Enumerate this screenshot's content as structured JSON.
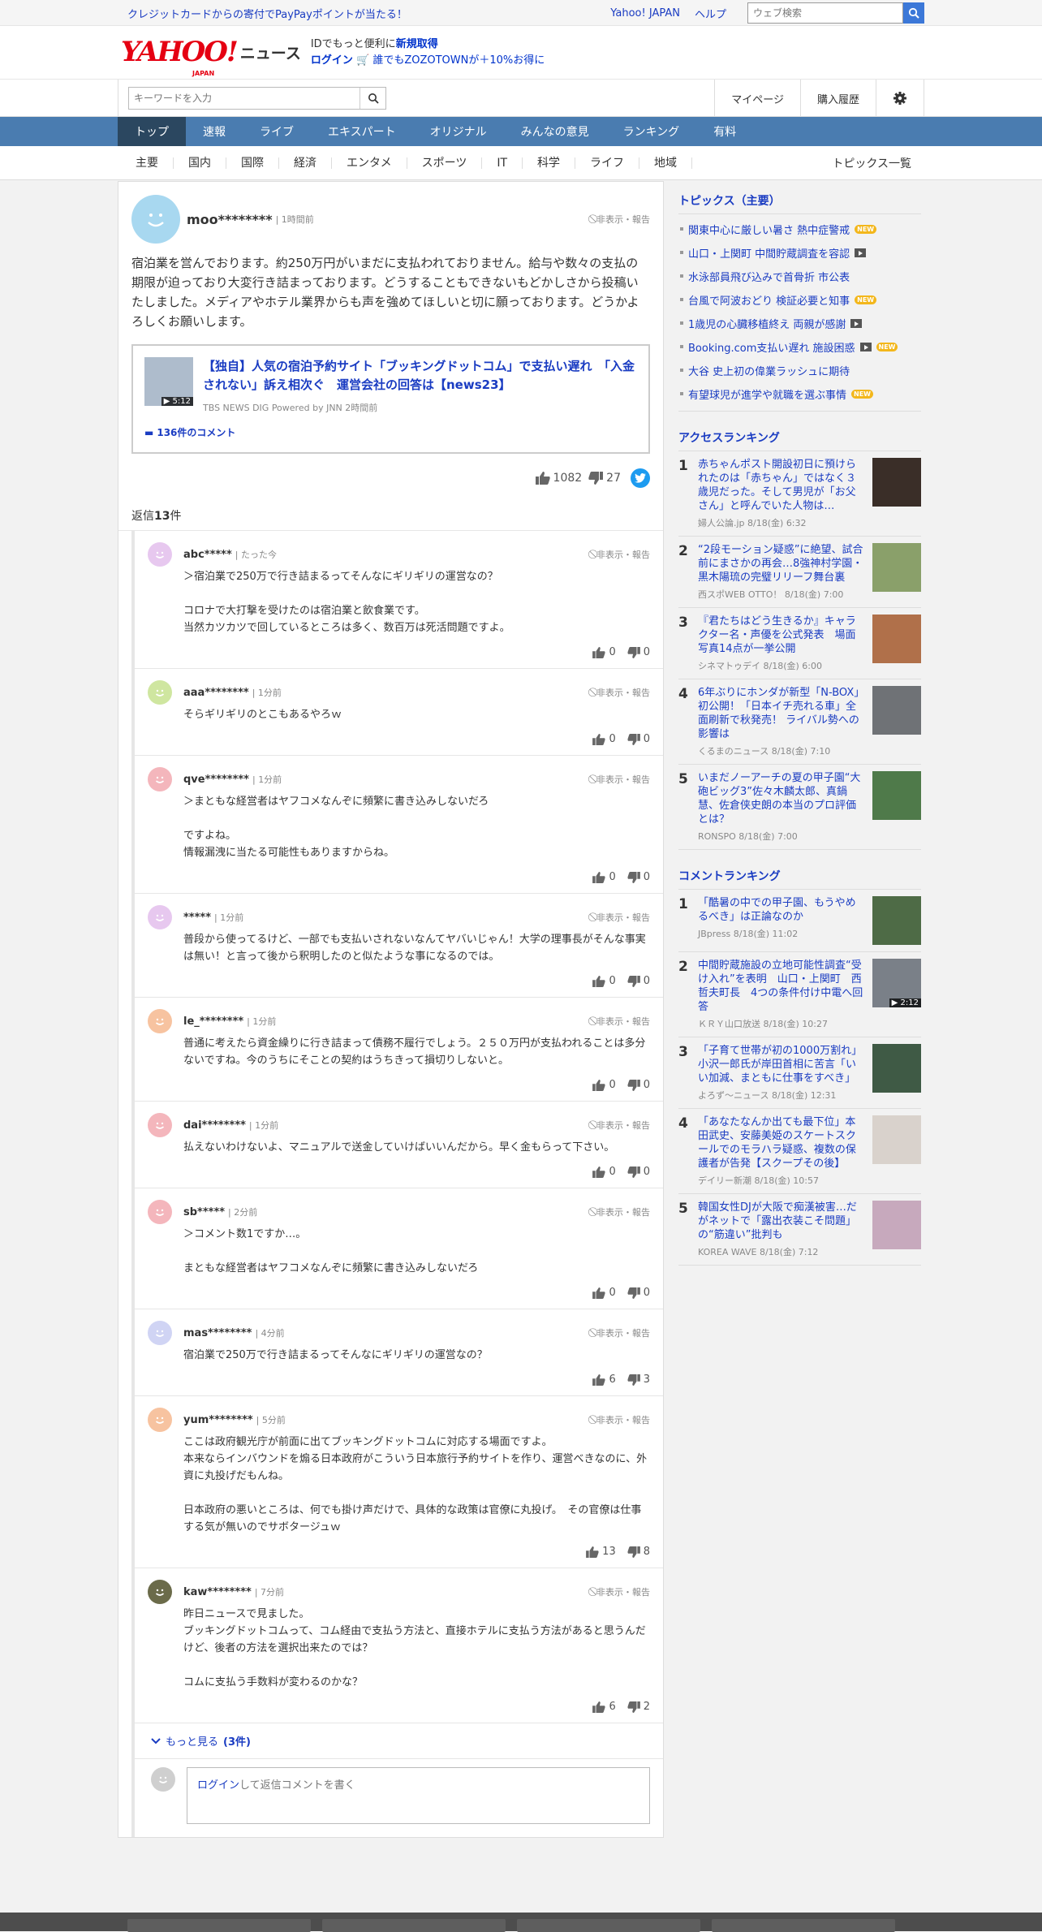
{
  "topbar": {
    "promo": "クレジットカードからの寄付でPayPayポイントが当たる！",
    "links": [
      "Yahoo! JAPAN",
      "ヘルプ"
    ],
    "web_search_placeholder": "ウェブ検索"
  },
  "header": {
    "logo_text": "YAHOO!",
    "logo_sub": "JAPAN",
    "service": "ニュース",
    "line1_prefix": "IDでもっと便利に",
    "line1_link": "新規取得",
    "line2_login": "ログイン",
    "line2_promo": "誰でもZOZOTOWNが＋10%お得に"
  },
  "search": {
    "placeholder": "キーワードを入力",
    "right_nav": [
      "マイページ",
      "購入履歴"
    ]
  },
  "main_nav": [
    "トップ",
    "速報",
    "ライブ",
    "エキスパート",
    "オリジナル",
    "みんなの意見",
    "ランキング",
    "有料"
  ],
  "sub_nav": [
    "主要",
    "国内",
    "国際",
    "経済",
    "エンタメ",
    "スポーツ",
    "IT",
    "科学",
    "ライフ",
    "地域"
  ],
  "sub_nav_right": "トピックス一覧",
  "main_comment": {
    "user": "moo********",
    "time": "1時間前",
    "report": "非表示・報告",
    "text": "宿泊業を営んでおります。約250万円がいまだに支払われておりません。給与や数々の支払の期限が迫っており大変行き詰まっております。どうすることもできないもどかしさから投稿いたしました。メディアやホテル業界からも声を強めてほしいと切に願っております。どうかよろしくお願いします。",
    "article_title": "【独自】人気の宿泊予約サイト「ブッキングドットコム」で支払い遅れ　「入金されない」訴え相次ぐ　運営会社の回答は【news23】",
    "article_source": "TBS NEWS DIG Powered by JNN 2時間前",
    "article_duration": "5:12",
    "comment_count": "136件のコメント",
    "likes": "1082",
    "dislikes": "27"
  },
  "reply_count_label": "返信",
  "reply_count_num": "13",
  "reply_count_suffix": "件",
  "replies": [
    {
      "user": "abc*****",
      "time": "たった今",
      "text": "＞宿泊業で250万で行き詰まるってそんなにギリギリの運営なの？\n\nコロナで大打撃を受けたのは宿泊業と飲食業です。\n当然カツカツで回しているところは多く、数百万は死活問題ですよ。",
      "likes": "0",
      "dislikes": "0",
      "color": "#e7c8ef"
    },
    {
      "user": "aaa********",
      "time": "1分前",
      "text": "そらギリギリのとこもあるやろｗ",
      "likes": "0",
      "dislikes": "0",
      "color": "#cfe6a0"
    },
    {
      "user": "qve********",
      "time": "1分前",
      "text": "＞まともな経営者はヤフコメなんぞに頻繁に書き込みしないだろ\n\nですよね。\n情報漏洩に当たる可能性もありますからね。",
      "likes": "0",
      "dislikes": "0",
      "color": "#f4b6bc"
    },
    {
      "user": "*****",
      "time": "1分前",
      "text": "普段から使ってるけど、一部でも支払いされないなんてヤバいじゃん！大学の理事長がそんな事実は無い！と言って後から釈明したのと似たような事になるのでは。",
      "likes": "0",
      "dislikes": "0",
      "color": "#e7c8ef"
    },
    {
      "user": "le_********",
      "time": "1分前",
      "text": "普通に考えたら資金繰りに行き詰まって債務不履行でしょう。２５０万円が支払われることは多分ないですね。今のうちにそことの契約はうちきって損切りしないと。",
      "likes": "0",
      "dislikes": "0",
      "color": "#f7c3a0"
    },
    {
      "user": "dai********",
      "time": "1分前",
      "text": "払えないわけないよ、マニュアルで送金していけばいいんだから。早く金もらって下さい。",
      "likes": "0",
      "dislikes": "0",
      "color": "#f4b6bc"
    },
    {
      "user": "sb*****",
      "time": "2分前",
      "text": "＞コメント数1ですか…。\n\nまともな経営者はヤフコメなんぞに頻繁に書き込みしないだろ",
      "likes": "0",
      "dislikes": "0",
      "color": "#f4b6bc"
    },
    {
      "user": "mas********",
      "time": "4分前",
      "text": "宿泊業で250万で行き詰まるってそんなにギリギリの運営なの？",
      "likes": "6",
      "dislikes": "3",
      "color": "#d0d4f4"
    },
    {
      "user": "yum********",
      "time": "5分前",
      "text": "ここは政府観光庁が前面に出てブッキングドットコムに対応する場面ですよ。\n本来ならインバウンドを煽る日本政府がこういう日本旅行予約サイトを作り、運営べきなのに、外資に丸投げだもんね。\n\n日本政府の悪いところは、何でも掛け声だけで、具体的な政策は官僚に丸投げ。　その官僚は仕事する気が無いのでサボタージュｗ",
      "likes": "13",
      "dislikes": "8",
      "color": "#f7c3a0"
    },
    {
      "user": "kaw********",
      "time": "7分前",
      "text": "昨日ニュースで見ました。\nブッキングドットコムって、コム経由で支払う方法と、直接ホテルに支払う方法があると思うんだけど、後者の方法を選択出来たのでは？\n\nコムに支払う手数料が変わるのかな？",
      "likes": "6",
      "dislikes": "2",
      "color": "#6b6b4a"
    }
  ],
  "reply_report": "非表示・報告",
  "more_label": "もっと見る",
  "more_count": "(3件)",
  "reply_form_login": "ログイン",
  "reply_form_text": "して返信コメントを書く",
  "sidebar": {
    "topics_title": "トピックス（主要）",
    "topics": [
      {
        "title": "関東中心に厳しい暑さ 熱中症警戒",
        "new": true,
        "video": false
      },
      {
        "title": "山口・上関町 中間貯蔵調査を容認",
        "new": false,
        "video": true
      },
      {
        "title": "水泳部員飛び込みで首骨折 市公表",
        "new": false,
        "video": false
      },
      {
        "title": "台風で阿波おどり 検証必要と知事",
        "new": true,
        "video": false
      },
      {
        "title": "1歳児の心臓移植終え 両親が感謝",
        "new": false,
        "video": true
      },
      {
        "title": "Booking.com支払い遅れ 施設困惑",
        "new": true,
        "video": true
      },
      {
        "title": "大谷 史上初の偉業ラッシュに期待",
        "new": false,
        "video": false
      },
      {
        "title": "有望球児が進学や就職を選ぶ事情",
        "new": true,
        "video": false
      }
    ],
    "new_label": "NEW",
    "access_title": "アクセスランキング",
    "access": [
      {
        "rank": "1",
        "title": "赤ちゃんポスト開設初日に預けられたのは「赤ちゃん」ではなく３歳児だった。そして男児が「お父さん」と呼んでいた人物は…",
        "source": "婦人公論.jp 8/18(金) 6:32",
        "img": "#3a2e28",
        "dur": ""
      },
      {
        "rank": "2",
        "title": "“2段モーション疑惑”に絶望、試合前にまさかの再会…8強神村学園・黒木陽琉の完璧リリーフ舞台裏",
        "source": "西スポWEB OTTO！ 8/18(金) 7:00",
        "img": "#8aa06a",
        "dur": ""
      },
      {
        "rank": "3",
        "title": "『君たちはどう生きるか』キャラクター名・声優を公式発表　場面写真14点が一挙公開",
        "source": "シネマトゥデイ 8/18(金) 6:00",
        "img": "#b0704a",
        "dur": ""
      },
      {
        "rank": "4",
        "title": "6年ぶりにホンダが新型「N-BOX」初公開！「日本イチ売れる車」全面刷新で秋発売！ ライバル勢への影響は",
        "source": "くるまのニュース 8/18(金) 7:10",
        "img": "#6f7276",
        "dur": ""
      },
      {
        "rank": "5",
        "title": "いまだノーアーチの夏の甲子園“大砲ビッグ3”佐々木麟太郎、真鍋慧、佐倉侠史朗の本当のプロ評価とは？",
        "source": "RONSPO 8/18(金) 7:00",
        "img": "#4f7a4a",
        "dur": ""
      }
    ],
    "comment_title": "コメントランキング",
    "comments": [
      {
        "rank": "1",
        "title": "「酷暑の中での甲子園、もうやめるべき」は正論なのか",
        "source": "JBpress 8/18(金) 11:02",
        "img": "#4e6b46",
        "dur": ""
      },
      {
        "rank": "2",
        "title": "中間貯蔵施設の立地可能性調査“受け入れ”を表明　山口・上関町　西哲夫町長　4つの条件付け中電へ回答",
        "source": "ＫＲＹ山口放送 8/18(金) 10:27",
        "img": "#7a8088",
        "dur": "2:12"
      },
      {
        "rank": "3",
        "title": "「子育て世帯が初の1000万割れ」小沢一郎氏が岸田首相に苦言「いい加減、まともに仕事をすべき」",
        "source": "よろず〜ニュース 8/18(金) 12:31",
        "img": "#3f5a45",
        "dur": ""
      },
      {
        "rank": "4",
        "title": "「あなたなんか出ても最下位」本田武史、安藤美姫のスケートスクールでのモラハラ疑惑、複数の保護者が告発【スクープその後】",
        "source": "デイリー新潮 8/18(金) 10:57",
        "img": "#d9d2cc",
        "dur": ""
      },
      {
        "rank": "5",
        "title": "韓国女性DJが大阪で痴漢被害…だがネットで「露出衣装こそ問題」の“筋違い”批判も",
        "source": "KOREA WAVE 8/18(金) 7:12",
        "img": "#c7a9bd",
        "dur": ""
      }
    ]
  }
}
